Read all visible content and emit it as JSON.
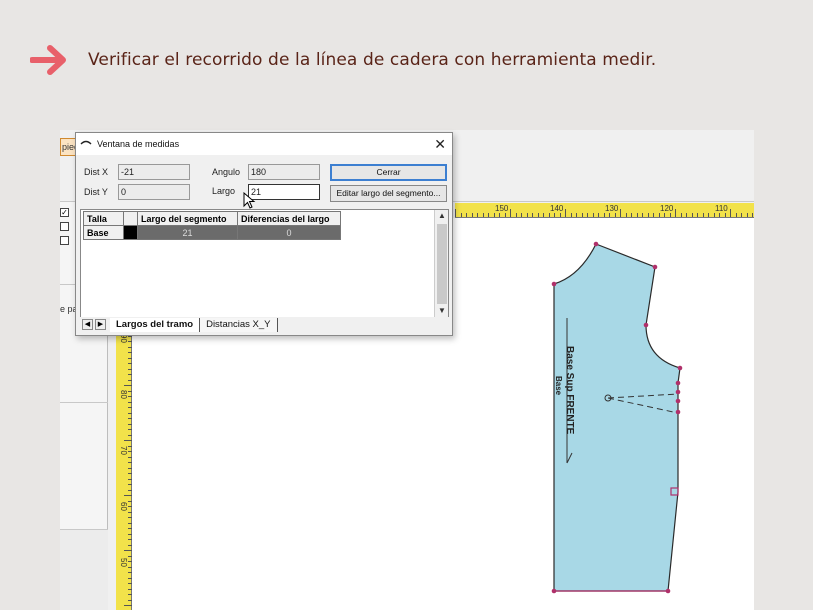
{
  "instruction": {
    "text": "Verificar el recorrido de la línea de cadera con herramienta medir.",
    "arrow_color": "#e8606a"
  },
  "app": {
    "partial_tab": "pied",
    "left_panel_label": "e pa",
    "checkbox_checked": true
  },
  "rulers": {
    "horizontal": [
      "150",
      "140",
      "130",
      "120",
      "110"
    ],
    "vertical": [
      "90",
      "80",
      "70",
      "60",
      "50"
    ]
  },
  "dialog": {
    "title": "Ventana de medidas",
    "close_glyph": "✕",
    "dist_x_label": "Dist X",
    "dist_x_value": "-21",
    "dist_y_label": "Dist Y",
    "dist_y_value": "0",
    "angulo_label": "Angulo",
    "angulo_value": "180",
    "largo_label": "Largo",
    "largo_value": "21",
    "cerrar_label": "Cerrar",
    "editar_label": "Editar largo del segmento...",
    "table": {
      "headers": [
        "Talla",
        "",
        "Largo del segmento",
        "Diferencias del largo"
      ],
      "rows": [
        {
          "talla": "Base",
          "largo": "21",
          "diferencia": "0"
        }
      ]
    },
    "tabs": [
      "Largos del tramo",
      "Distancias X_Y"
    ],
    "active_tab": "Largos del tramo"
  },
  "pattern": {
    "fill_color": "#a8d8e6",
    "label_main": "Base Sup FRENTE",
    "label_sub": "Base"
  }
}
